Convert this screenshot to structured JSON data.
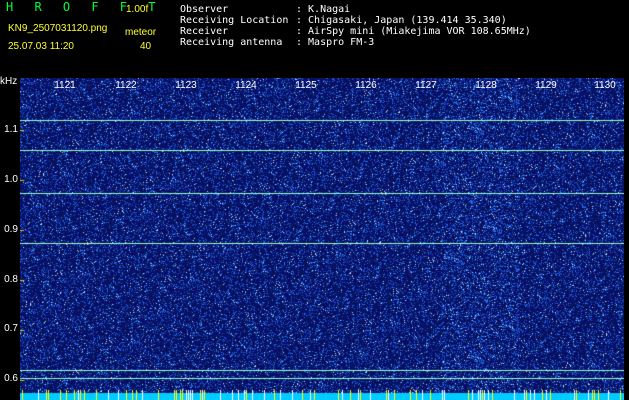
{
  "header": {
    "brand": "H R O F F T",
    "version": "1.00f",
    "filename": "KN9_2507031120.png",
    "mode": "meteor",
    "timestamp": "25.07.03 11:20",
    "count": "40",
    "info": [
      {
        "label": "Observer",
        "value": ": K.Nagai"
      },
      {
        "label": "Receiving Location",
        "value": ": Chigasaki, Japan (139.414 35.340)"
      },
      {
        "label": "Receiver",
        "value": ": AirSpy mini (Miakejima VOR 108.65MHz)"
      },
      {
        "label": "Receiving antenna",
        "value": ": Maspro FM-3"
      }
    ]
  },
  "plot": {
    "y_unit": "kHz",
    "y_labels": [
      "1.1",
      "1.0",
      "0.9",
      "0.8",
      "0.7",
      "0.6"
    ],
    "x_labels": [
      "1121",
      "1122",
      "1123",
      "1124",
      "1125",
      "1126",
      "1127",
      "1128",
      "1129",
      "1130"
    ],
    "carrier_lines_khz": [
      1.12,
      1.06,
      0.975,
      0.875,
      0.62,
      0.605
    ],
    "colors": {
      "background": "#0a0a66",
      "noise": "#3355ff",
      "line": "#99ffcc",
      "baseline": "#00ccff"
    }
  }
}
